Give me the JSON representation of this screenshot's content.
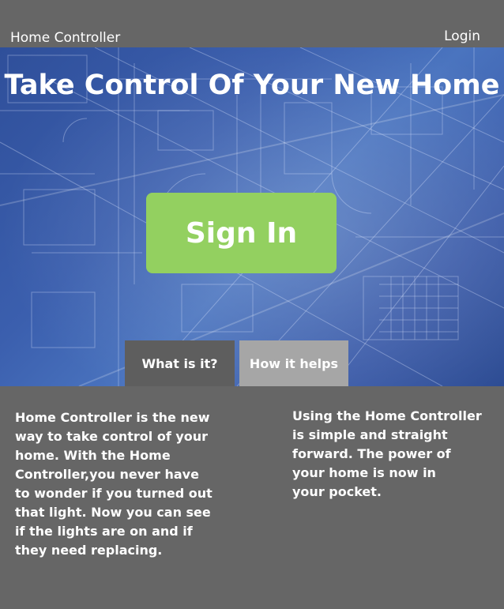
{
  "header": {
    "brand": "Home Controller",
    "login_label": "Login"
  },
  "hero": {
    "title": "Take Control Of Your New Home",
    "signin_label": "Sign In"
  },
  "tabs": [
    {
      "label": "What is it?",
      "selected": true
    },
    {
      "label": "How it helps",
      "selected": false
    }
  ],
  "content": {
    "left_text": "Home Controller is the new\nway to take control of your\nhome. With the Home\nController,you never have\nto wonder if you turned out\nthat light. Now you can see\nif the lights are on and if\nthey need replacing.",
    "right_text": "Using the Home Controller\nis simple and straight\nforward. The  power of\nyour home is now in\nyour pocket."
  },
  "colors": {
    "background": "#666666",
    "signin_button": "#93d060",
    "tab_selected": "#5e5e5e",
    "tab_unselected": "#a6a6a6",
    "hero_blue": "#3b5fae"
  }
}
